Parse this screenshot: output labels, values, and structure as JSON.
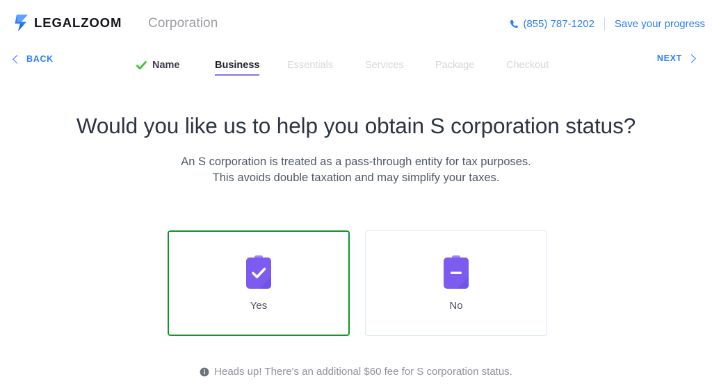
{
  "header": {
    "logo_icon": "legalzoom-z-bolt-icon",
    "logo_word": "LEGALZOOM",
    "product_name": "Corporation",
    "phone_icon": "phone-icon",
    "phone": "(855) 787-1202",
    "save_progress": "Save your progress"
  },
  "nav": {
    "back_label": "BACK",
    "back_icon": "chevron-left-icon",
    "next_label": "NEXT",
    "next_icon": "chevron-right-icon",
    "steps": [
      {
        "label": "Name",
        "state": "done",
        "icon": "green-check-icon"
      },
      {
        "label": "Business",
        "state": "active",
        "icon": ""
      },
      {
        "label": "Essentials",
        "state": "todo",
        "icon": ""
      },
      {
        "label": "Services",
        "state": "todo",
        "icon": ""
      },
      {
        "label": "Package",
        "state": "todo",
        "icon": ""
      },
      {
        "label": "Checkout",
        "state": "todo",
        "icon": ""
      }
    ]
  },
  "main": {
    "headline": "Would you like us to help you obtain S corporation status?",
    "subcopy_line1": "An S corporation is treated as a pass-through entity for tax purposes.",
    "subcopy_line2": "This avoids double taxation and may simplify your taxes.",
    "options": [
      {
        "label": "Yes",
        "icon": "clipboard-check-icon",
        "selected": true
      },
      {
        "label": "No",
        "icon": "clipboard-minus-icon",
        "selected": false
      }
    ]
  },
  "footer": {
    "info_icon": "info-circle-icon",
    "note": "Heads up! There's an additional $60 fee for S corporation status."
  },
  "colors": {
    "brand_blue": "#2a7dfb",
    "logo_dark": "#12141a",
    "selected_green": "#0f9628",
    "check_green": "#3ac430",
    "active_underline_purple": "#8b6fe8",
    "icon_purple": "#7c5cf0",
    "unselected_border": "#dce6f7",
    "heading_dark": "#2b3443",
    "muted_gray": "#9a9da3"
  }
}
